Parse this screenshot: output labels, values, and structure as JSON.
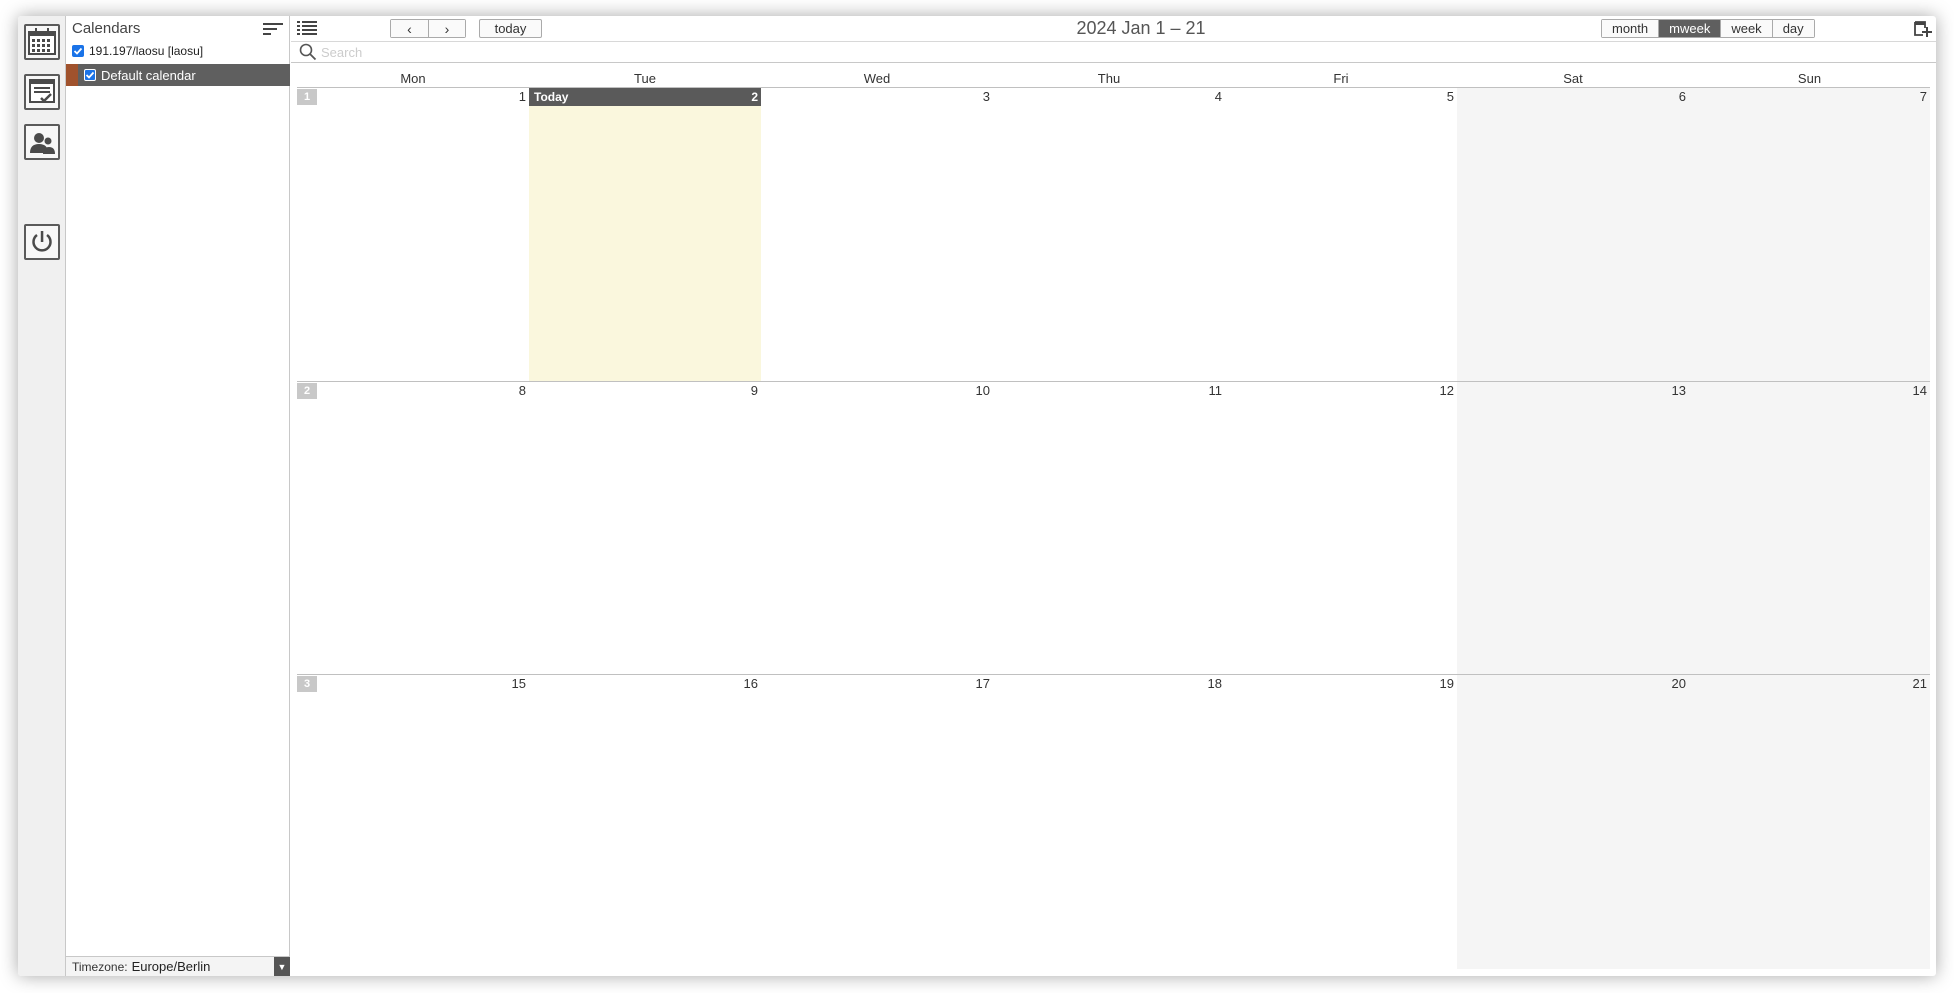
{
  "sidebar": {
    "title": "Calendars",
    "account": "191.197/laosu [laosu]",
    "calendar": "Default calendar",
    "timezone_label": "Timezone:",
    "timezone_value": "Europe/Berlin"
  },
  "toolbar": {
    "prev": "‹",
    "next": "›",
    "today": "today",
    "range_title": "2024 Jan 1 – 21",
    "views": [
      "month",
      "mweek",
      "week",
      "day"
    ],
    "active_view": "mweek"
  },
  "search": {
    "placeholder": "Search"
  },
  "calendar": {
    "weekdays": [
      "Mon",
      "Tue",
      "Wed",
      "Thu",
      "Fri",
      "Sat",
      "Sun"
    ],
    "today_label": "Today",
    "weeks": [
      {
        "number": "1",
        "days": [
          "1",
          "2",
          "3",
          "4",
          "5",
          "6",
          "7"
        ]
      },
      {
        "number": "2",
        "days": [
          "8",
          "9",
          "10",
          "11",
          "12",
          "13",
          "14"
        ]
      },
      {
        "number": "3",
        "days": [
          "15",
          "16",
          "17",
          "18",
          "19",
          "20",
          "21"
        ]
      }
    ]
  },
  "colors": {
    "accent": "#5f5f5f",
    "calendar_color": "#a0522d",
    "today_bg": "#faf7dd",
    "weekend_bg": "#f5f5f5"
  }
}
